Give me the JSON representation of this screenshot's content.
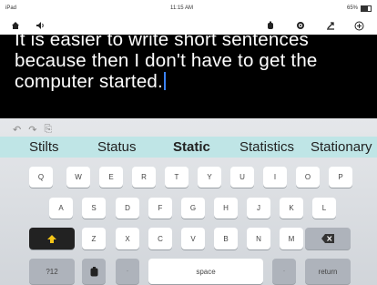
{
  "status": {
    "left": "iPad",
    "time": "11:15 AM",
    "battery": "65%"
  },
  "toolbar": {
    "home_icon": "home-icon",
    "speaker_icon": "speaker-icon",
    "cog_icon": "gear-icon",
    "settings_icon": "settings-icon",
    "share_icon": "share-icon",
    "add_icon": "plus-icon"
  },
  "editor": {
    "line1": "It is easier to write short sentences",
    "line2": "because then I don't have to get the",
    "line3": "computer started."
  },
  "undo": {
    "undo": "↶",
    "redo": "↷",
    "paste": "⎘"
  },
  "suggestions": [
    "Stilts",
    "Status",
    "Static",
    "Statistics",
    "Stationary"
  ],
  "keyboard": {
    "row1": [
      "Q",
      "W",
      "E",
      "R",
      "T",
      "Y",
      "U",
      "I",
      "O",
      "P"
    ],
    "row2": [
      "A",
      "S",
      "D",
      "F",
      "G",
      "H",
      "J",
      "K",
      "L"
    ],
    "row3": [
      "Z",
      "X",
      "C",
      "V",
      "B",
      "N",
      "M"
    ],
    "numbers": "?12",
    "space": "space",
    "return": "return"
  }
}
